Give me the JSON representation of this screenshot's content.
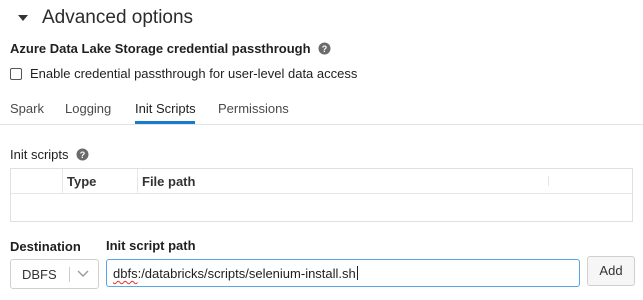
{
  "advanced": {
    "title": "Advanced options",
    "expanded_icon": "caret-down-icon"
  },
  "adls": {
    "title": "Azure Data Lake Storage credential passthrough",
    "help_icon": "help-circle-icon",
    "checkbox_label": "Enable credential passthrough for user-level data access",
    "checkbox_checked": false
  },
  "tabs": [
    {
      "label": "Spark",
      "active": false
    },
    {
      "label": "Logging",
      "active": false
    },
    {
      "label": "Init Scripts",
      "active": true
    },
    {
      "label": "Permissions",
      "active": false
    }
  ],
  "init_scripts": {
    "title": "Init scripts",
    "help_icon": "help-circle-icon",
    "columns": [
      "",
      "Type",
      "File path"
    ],
    "rows": []
  },
  "destination": {
    "label": "Destination",
    "value": "DBFS",
    "icon": "chevron-down-icon"
  },
  "path": {
    "label": "Init script path",
    "value_prefix": "dbfs",
    "value_rest": ":/databricks/scripts/selenium-install.sh"
  },
  "add_button": {
    "label": "Add"
  },
  "colors": {
    "accent": "#1b7ac9",
    "focus_border": "#58a8e8",
    "spellcheck": "#e03030"
  }
}
